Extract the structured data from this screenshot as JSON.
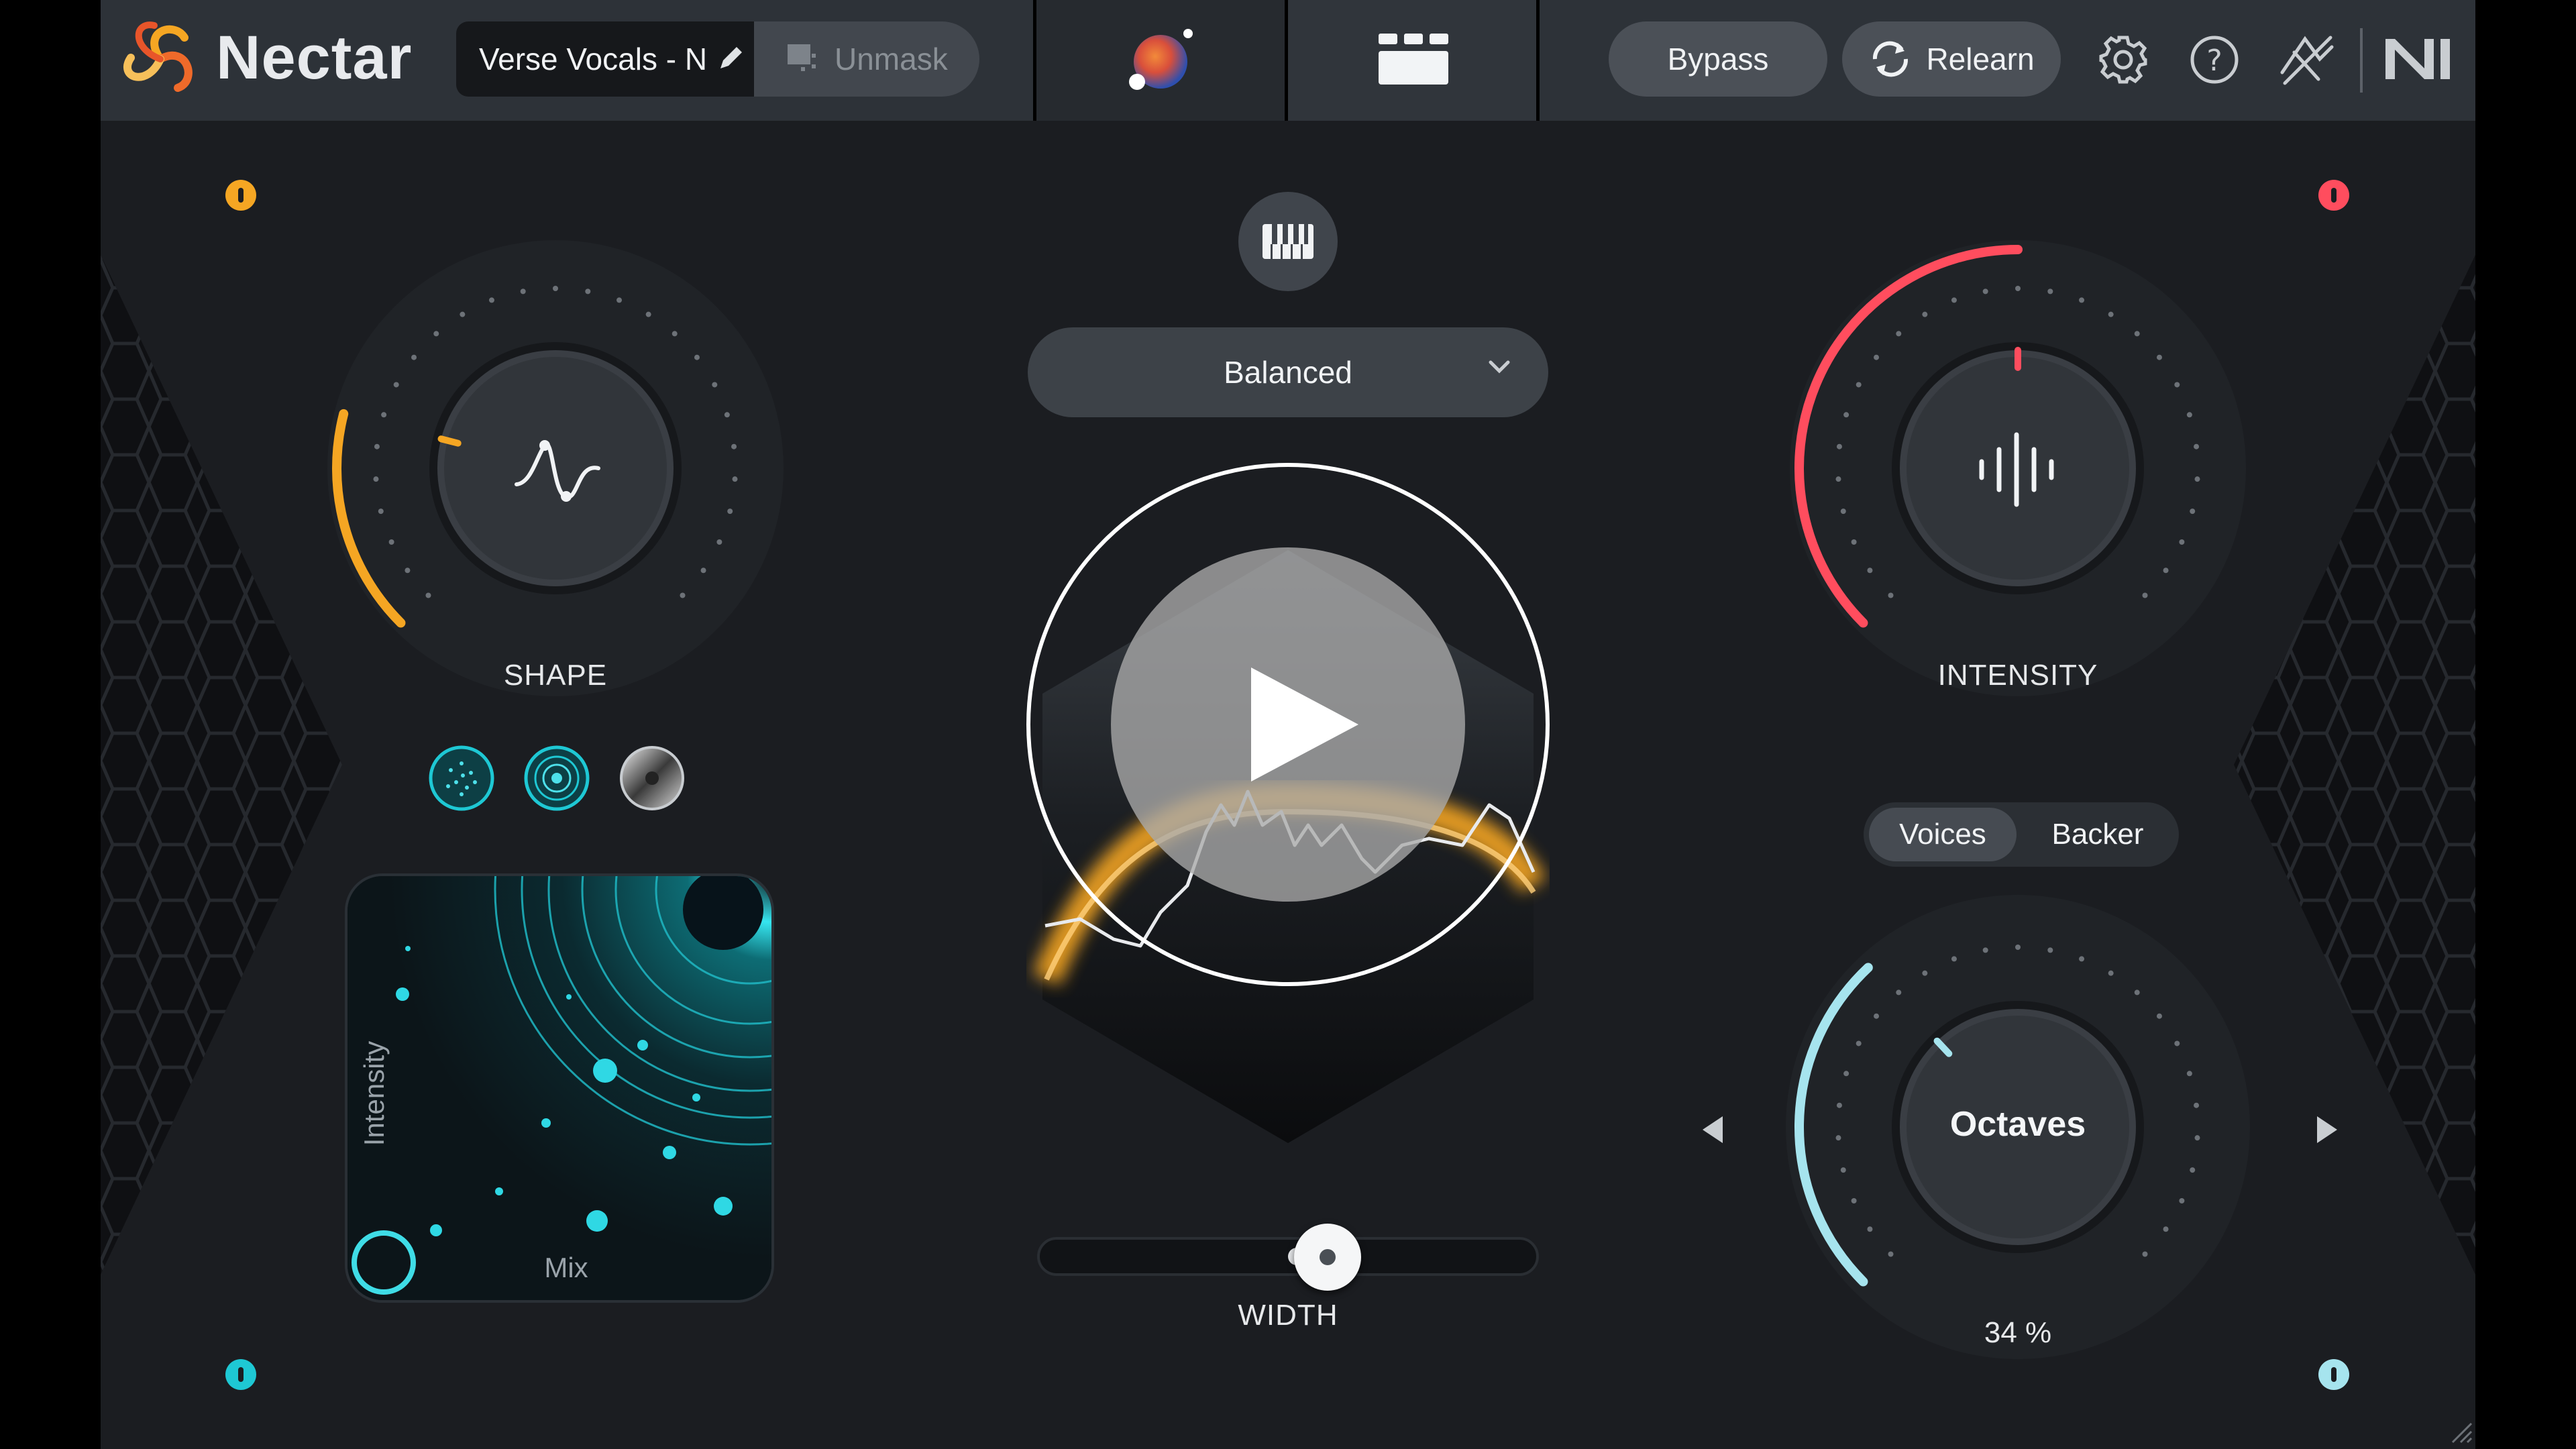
{
  "app": {
    "name": "Nectar",
    "preset_name": "Verse Vocals - N",
    "unmask_label": "Unmask",
    "bypass_label": "Bypass",
    "relearn_label": "Relearn"
  },
  "center": {
    "style_selected": "Balanced",
    "width_label": "WIDTH",
    "width_value": 0.58
  },
  "shape": {
    "label": "SHAPE",
    "value": 0.22
  },
  "xy_pad": {
    "y_label": "Intensity",
    "x_label": "Mix"
  },
  "intensity": {
    "label": "INTENSITY",
    "value": 0.5
  },
  "tabs": [
    "Voices",
    "Backer"
  ],
  "voices": {
    "mode": "Octaves",
    "amount_display": "34 %",
    "value": 0.34
  },
  "colors": {
    "shape_accent": "#f5a623",
    "intensity_accent": "#ff4d5e",
    "voices_accent": "#a6e4ee",
    "teal": "#1ec8d4"
  },
  "icons": [
    "nectar-logo-icon",
    "pencil-icon",
    "unmask-icon",
    "visualizer-orb-icon",
    "grid-view-icon",
    "relearn-icon",
    "gear-icon",
    "help-icon",
    "ozone-link-icon",
    "ni-logo-icon",
    "piano-keys-icon",
    "chevron-down-icon",
    "play-icon",
    "previous-arrow-icon",
    "next-arrow-icon"
  ]
}
